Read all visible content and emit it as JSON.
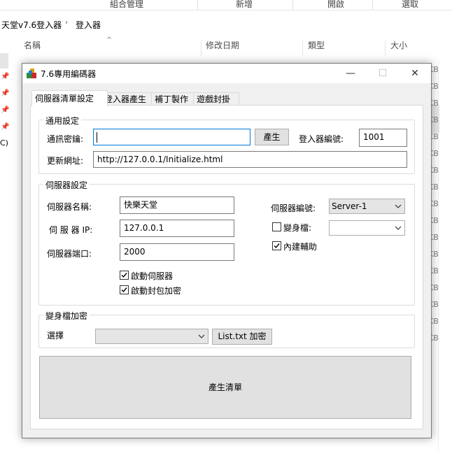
{
  "explorer": {
    "ribbon": [
      "組合管理",
      "新增",
      "開啟",
      "選取"
    ],
    "breadcrumb": [
      "天堂v7.6登入器",
      "登入器"
    ],
    "columns": [
      "名稱",
      "修改日期",
      "類型",
      "大小"
    ],
    "nav_partial": "C)",
    "size_suffix": "KB"
  },
  "window": {
    "title": "7.6專用編碼器",
    "minimize": "—",
    "maximize": "☐",
    "close": "✕"
  },
  "tabs": [
    "伺服器清單設定",
    "登入器產生",
    "補丁製作",
    "遊戲封掛"
  ],
  "general": {
    "title": "通用設定",
    "key_label": "通訊密鑰:",
    "key_value": "",
    "generate_button": "產生",
    "launcher_id_label": "登入器編號:",
    "launcher_id_value": "1001",
    "update_url_label": "更新網址:",
    "update_url_value": "http://127.0.0.1/Initialize.html"
  },
  "server": {
    "title": "伺服器設定",
    "name_label": "伺服器名稱:",
    "name_value": "快樂天堂",
    "ip_label": "伺 服 器 IP:",
    "ip_value": "127.0.0.1",
    "port_label": "伺服器端口:",
    "port_value": "2000",
    "server_id_label": "伺服器編號:",
    "server_id_value": "Server-1",
    "morph_label": "變身檔:",
    "morph_checked": false,
    "morph_value": "",
    "builtin_assist_label": "內建輔助",
    "builtin_assist_checked": true,
    "start_server_label": "啟動伺服器",
    "start_server_checked": true,
    "packet_encrypt_label": "啟動封包加密",
    "packet_encrypt_checked": true
  },
  "morph_encrypt": {
    "title": "變身檔加密",
    "select_label": "選擇",
    "select_value": "",
    "encrypt_button": "List.txt 加密"
  },
  "generate_list_button": "產生清單",
  "colors": {
    "accent": "#0078d7",
    "dialog_bg": "#f0f0f0",
    "button_bg": "#e1e1e1"
  }
}
